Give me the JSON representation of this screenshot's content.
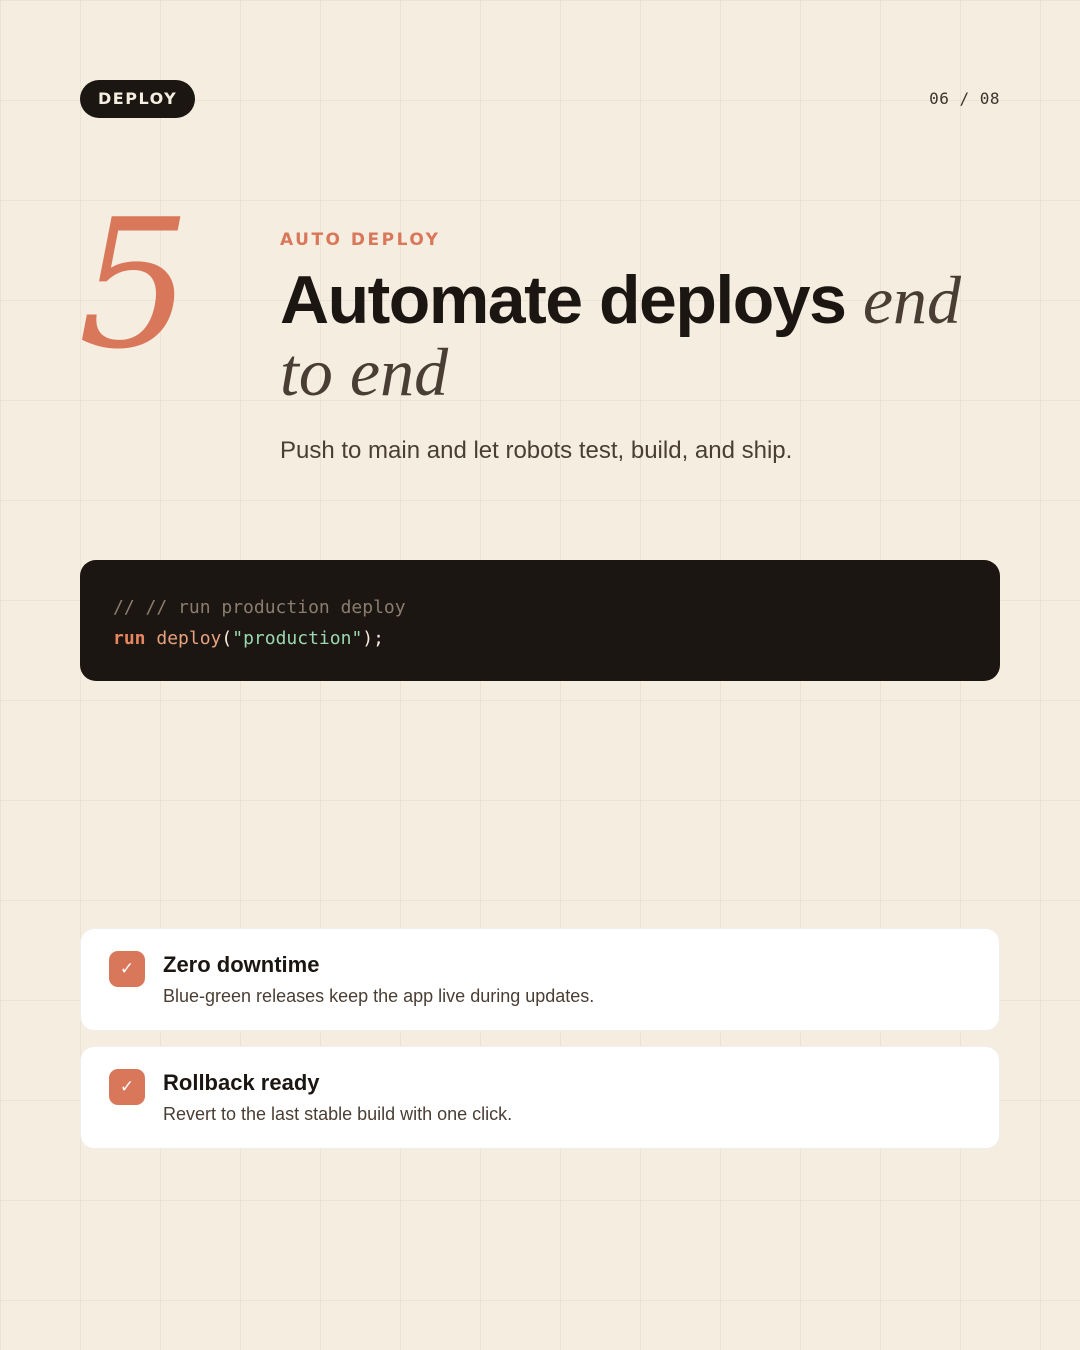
{
  "header": {
    "badge": "DEPLOY",
    "page_counter": "06 / 08"
  },
  "step": {
    "number": "5",
    "eyebrow": "AUTO DEPLOY",
    "headline_main": "Automate deploys",
    "headline_accent": "end to end",
    "subtitle": "Push to main and let robots test, build, and ship."
  },
  "code": {
    "comment": "// // run production deploy",
    "keyword": "run",
    "function": "deploy",
    "open_paren": "(",
    "string": "\"production\"",
    "close": ");"
  },
  "features": [
    {
      "icon": "check-icon",
      "check": "✓",
      "title": "Zero downtime",
      "description": "Blue-green releases keep the app live during updates."
    },
    {
      "icon": "check-icon",
      "check": "✓",
      "title": "Rollback ready",
      "description": "Revert to the last stable build with one click."
    }
  ],
  "colors": {
    "background": "#f4ede0",
    "accent": "#d9775a",
    "dark": "#1c1612",
    "code_string": "#9ad8b0"
  }
}
